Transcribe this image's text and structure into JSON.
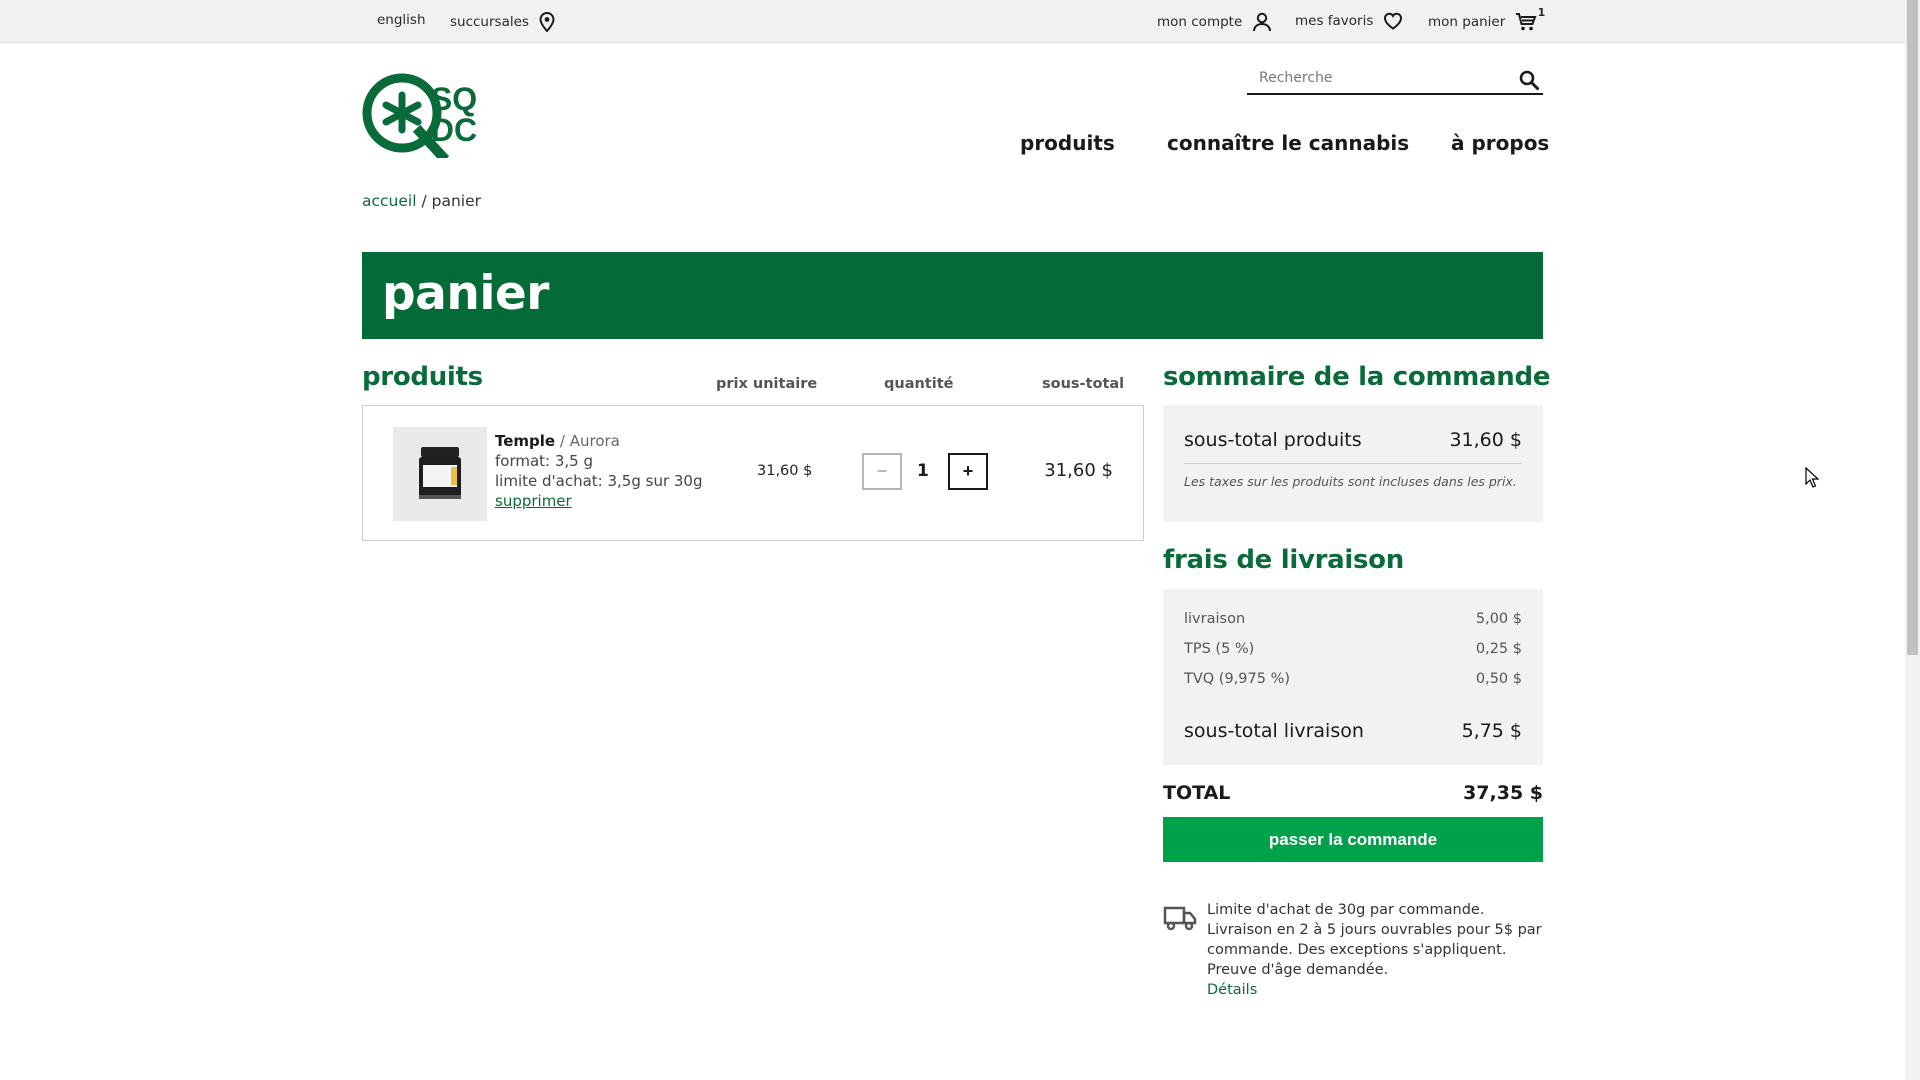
{
  "topbar": {
    "language": "english",
    "stores": "succursales",
    "account": "mon compte",
    "favorites": "mes favoris",
    "cart": "mon panier",
    "cart_count": "1"
  },
  "brand": {
    "logo_text_top": "SQ",
    "logo_text_bottom": "DC",
    "color": "#0a6b3a"
  },
  "search": {
    "placeholder": "Recherche"
  },
  "nav": [
    "produits",
    "connaître le cannabis",
    "à propos"
  ],
  "breadcrumb": {
    "home": "accueil",
    "separator": "/",
    "current": "panier"
  },
  "page_title": "panier",
  "cart": {
    "section_title": "produits",
    "columns": {
      "unit_price": "prix unitaire",
      "quantity": "quantité",
      "subtotal": "sous-total"
    },
    "items": [
      {
        "name": "Temple",
        "brand": "/ Aurora",
        "format": "format: 3,5 g",
        "limit": "limite d'achat: 3,5g sur 30g",
        "remove": "supprimer",
        "unit_price": "31,60 $",
        "minus": "−",
        "quantity": "1",
        "plus": "+",
        "subtotal": "31,60 $"
      }
    ]
  },
  "summary": {
    "title": "sommaire de la commande",
    "products_label": "sous-total produits",
    "products_value": "31,60 $",
    "tax_note": "Les taxes sur les produits sont incluses dans les prix."
  },
  "shipping": {
    "title": "frais de livraison",
    "lines": [
      {
        "label": "livraison",
        "value": "5,00 $"
      },
      {
        "label": "TPS (5 %)",
        "value": "0,25 $"
      },
      {
        "label": "TVQ (9,975 %)",
        "value": "0,50 $"
      }
    ],
    "subtotal_label": "sous-total livraison",
    "subtotal_value": "5,75 $"
  },
  "total": {
    "label": "TOTAL",
    "value": "37,35 $"
  },
  "checkout_label": "passer la commande",
  "notice": {
    "text": "Limite d'achat de 30g par commande. Livraison en 2 à 5 jours ouvrables pour 5$ par commande. Des exceptions s'appliquent. Preuve d'âge demandée.",
    "link": "Détails"
  },
  "colors": {
    "brand_green": "#046b38",
    "button_green": "#00a14b",
    "panel_bg": "#f3f2f0"
  }
}
